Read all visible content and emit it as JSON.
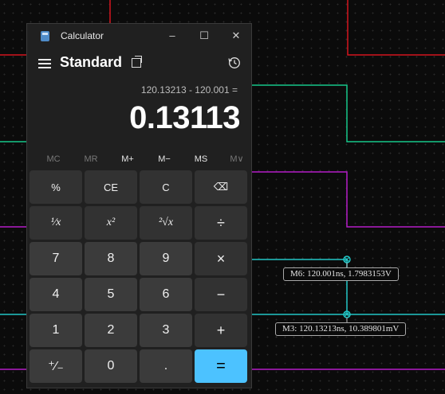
{
  "background": {
    "markers": [
      {
        "label": "M6: 120.001ns, 1.7983153V"
      },
      {
        "label": "M3: 120.13213ns, 10.389801mV"
      }
    ],
    "colors": {
      "trace_red": "#d4141e",
      "trace_green": "#16c88a",
      "trace_magenta": "#b41cc8",
      "trace_cyan": "#22c6c6"
    }
  },
  "calculator": {
    "app_title": "Calculator",
    "window_buttons": {
      "minimize": "–",
      "maximize": "☐",
      "close": "✕"
    },
    "mode_title": "Standard",
    "expression": "120.13213 - 120.001 =",
    "result": "0.13113",
    "memory": [
      "MC",
      "MR",
      "M+",
      "M−",
      "MS",
      "M∨"
    ],
    "keys": [
      [
        "%",
        "CE",
        "C",
        "⌫"
      ],
      [
        "¹⁄x",
        "x²",
        "²√x",
        "÷"
      ],
      [
        "7",
        "8",
        "9",
        "×"
      ],
      [
        "4",
        "5",
        "6",
        "−"
      ],
      [
        "1",
        "2",
        "3",
        "+"
      ],
      [
        "⁺⁄₋",
        "0",
        ".",
        "="
      ]
    ],
    "accent_color": "#4cc2ff"
  }
}
